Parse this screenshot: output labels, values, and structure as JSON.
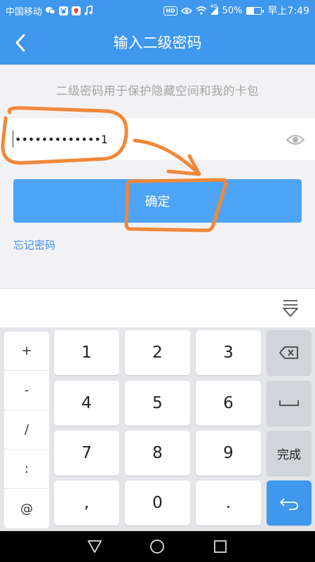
{
  "status_bar": {
    "carrier": "中国移动",
    "network": "4G",
    "battery": "50%",
    "time": "早上7:49",
    "icons": [
      "wechat-icon",
      "baidu-icon",
      "map-icon",
      "music-icon",
      "hd-icon",
      "eye-icon",
      "wifi-icon",
      "signal-icon",
      "battery-icon"
    ],
    "battery_level": 0.5,
    "hd_label": "HD"
  },
  "header": {
    "title": "输入二级密码",
    "back_icon": "chevron-left-icon",
    "background": "#3f97ee"
  },
  "content": {
    "subtitle": "二级密码用于保护隐藏空间和我的卡包",
    "password_value": "•••••••••••••1",
    "show_password_icon": "eye-icon",
    "confirm_label": "确定",
    "forgot_label": "忘记密码"
  },
  "keyboard": {
    "hide_icon": "keyboard-hide-icon",
    "symbols": [
      "+",
      "-",
      "/",
      ":",
      "@"
    ],
    "rows": [
      [
        "1",
        "2",
        "3"
      ],
      [
        "4",
        "5",
        "6"
      ],
      [
        "7",
        "8",
        "9"
      ],
      [
        ",",
        "0",
        "."
      ]
    ],
    "backspace_icon": "backspace-icon",
    "space_icon": "space-icon",
    "done_label": "完成",
    "enter_icon": "enter-icon",
    "accent": "#3f97ee"
  },
  "nav_bar": {
    "icons": [
      "back-triangle-icon",
      "home-circle-icon",
      "recent-square-icon"
    ]
  },
  "annotations": {
    "color": "#f0883a"
  }
}
